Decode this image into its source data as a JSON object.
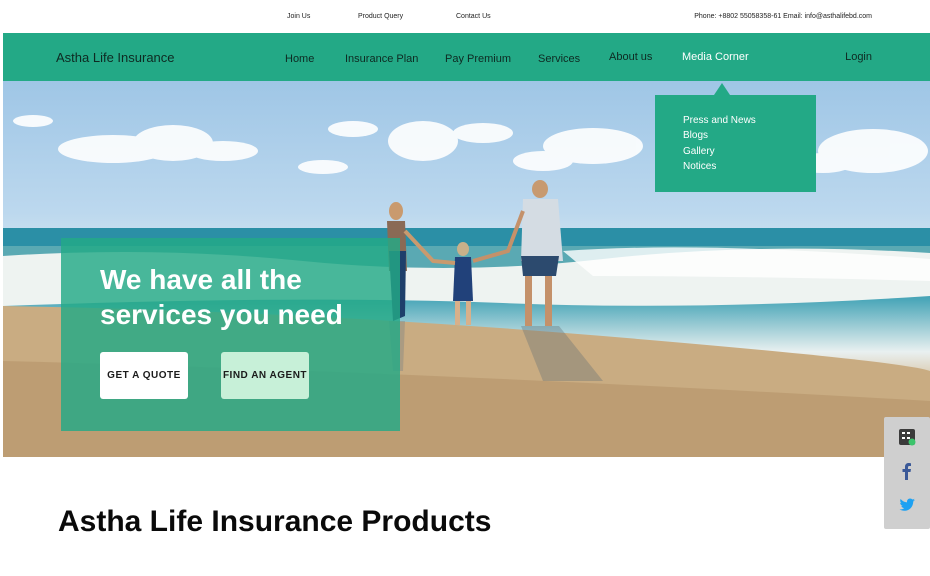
{
  "topbar": {
    "links": [
      "Join Us",
      "Product Query",
      "Contact Us"
    ],
    "contact": "Phone: +8802 55058358-61 Email: info@asthalifebd.com"
  },
  "nav": {
    "brand": "Astha Life Insurance",
    "items": [
      "Home",
      "Insurance Plan",
      "Pay Premium",
      "Services",
      "About us",
      "Media Corner"
    ],
    "active": "Media Corner",
    "login": "Login"
  },
  "dropdown": {
    "items": [
      "Press and News",
      "Blogs",
      "Gallery",
      "Notices"
    ]
  },
  "hero": {
    "title": "We have all the services you need",
    "quote_button": "GET A QUOTE",
    "agent_button": "FIND AN AGENT"
  },
  "social": {
    "icons": [
      "calculator-icon",
      "facebook-icon",
      "twitter-icon"
    ]
  },
  "products": {
    "title": "Astha Life Insurance Products"
  },
  "colors": {
    "brand_green": "#23a986",
    "light_green": "#c7f0d8",
    "social_bg": "#cfcfcf",
    "facebook": "#3b5998",
    "twitter": "#1da1f2"
  }
}
